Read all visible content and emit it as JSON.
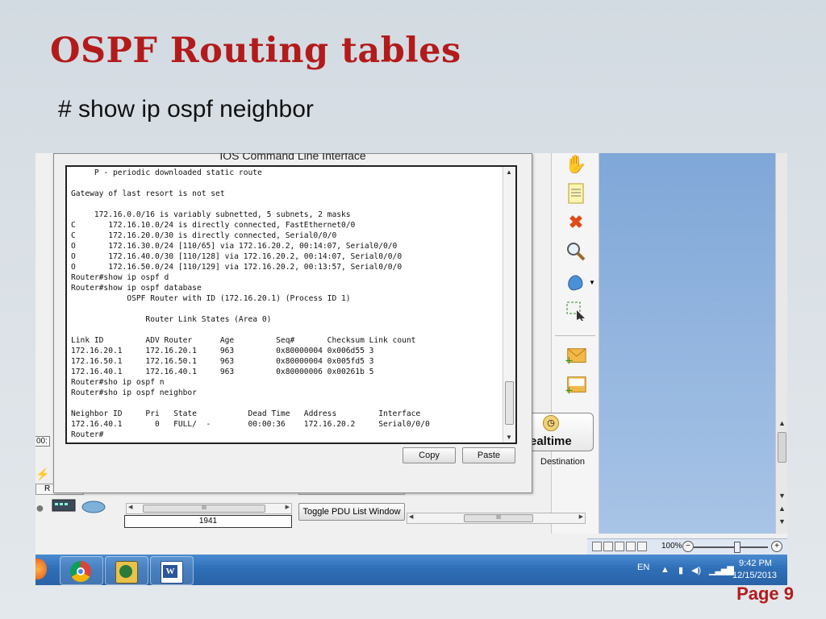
{
  "slide": {
    "title": "OSPF Routing tables",
    "subtitle": "# show ip ospf neighbor",
    "page_label": "Page 9"
  },
  "cli_window": {
    "title": "IOS Command Line Interface",
    "lines": [
      "     P - periodic downloaded static route",
      "",
      "Gateway of last resort is not set",
      "",
      "     172.16.0.0/16 is variably subnetted, 5 subnets, 2 masks",
      "C       172.16.10.0/24 is directly connected, FastEthernet0/0",
      "C       172.16.20.0/30 is directly connected, Serial0/0/0",
      "O       172.16.30.0/24 [110/65] via 172.16.20.2, 00:14:07, Serial0/0/0",
      "O       172.16.40.0/30 [110/128] via 172.16.20.2, 00:14:07, Serial0/0/0",
      "O       172.16.50.0/24 [110/129] via 172.16.20.2, 00:13:57, Serial0/0/0",
      "Router#show ip ospf d",
      "Router#show ip ospf database",
      "            OSPF Router with ID (172.16.20.1) (Process ID 1)",
      "",
      "                Router Link States (Area 0)",
      "",
      "Link ID         ADV Router      Age         Seq#       Checksum Link count",
      "172.16.20.1     172.16.20.1     963         0x80000004 0x006d55 3",
      "172.16.50.1     172.16.50.1     963         0x80000004 0x005fd5 3",
      "172.16.40.1     172.16.40.1     963         0x80000006 0x00261b 5",
      "Router#sho ip ospf n",
      "Router#sho ip ospf neighbor",
      "",
      "Neighbor ID     Pri   State           Dead Time   Address         Interface",
      "172.16.40.1       0   FULL/  -        00:00:36    172.16.20.2     Serial0/0/0",
      "Router#"
    ],
    "copy_label": "Copy",
    "paste_label": "Paste"
  },
  "workspace": {
    "realtime_label": "ealtime",
    "destination_label": "Destination",
    "toggle_pdu_label": "Toggle PDU List Window",
    "device_model": "1941",
    "time_fragment": "00:",
    "tab_fragment": "R",
    "scroll_thumb_mark": "III"
  },
  "word_status": {
    "zoom": "100%",
    "zoom_level_percent": 100
  },
  "taskbar": {
    "language": "EN",
    "time": "9:42 PM",
    "date": "12/15/2013"
  },
  "colors": {
    "title_red": "#b31b1b",
    "taskbar_blue": "#2f6fb8",
    "canvas_blue": "#8fb2de"
  },
  "icons": {
    "toolbar": [
      "hand-icon",
      "note-icon",
      "delete-icon",
      "magnifier-icon",
      "shape-icon",
      "select-area-icon",
      "simple-pdu-icon",
      "complex-pdu-icon"
    ],
    "taskbar": [
      "firefox-icon",
      "chrome-icon",
      "packet-tracer-icon",
      "word-icon"
    ],
    "tray": [
      "show-hidden-icons-icon",
      "battery-icon",
      "volume-icon",
      "signal-icon"
    ]
  }
}
